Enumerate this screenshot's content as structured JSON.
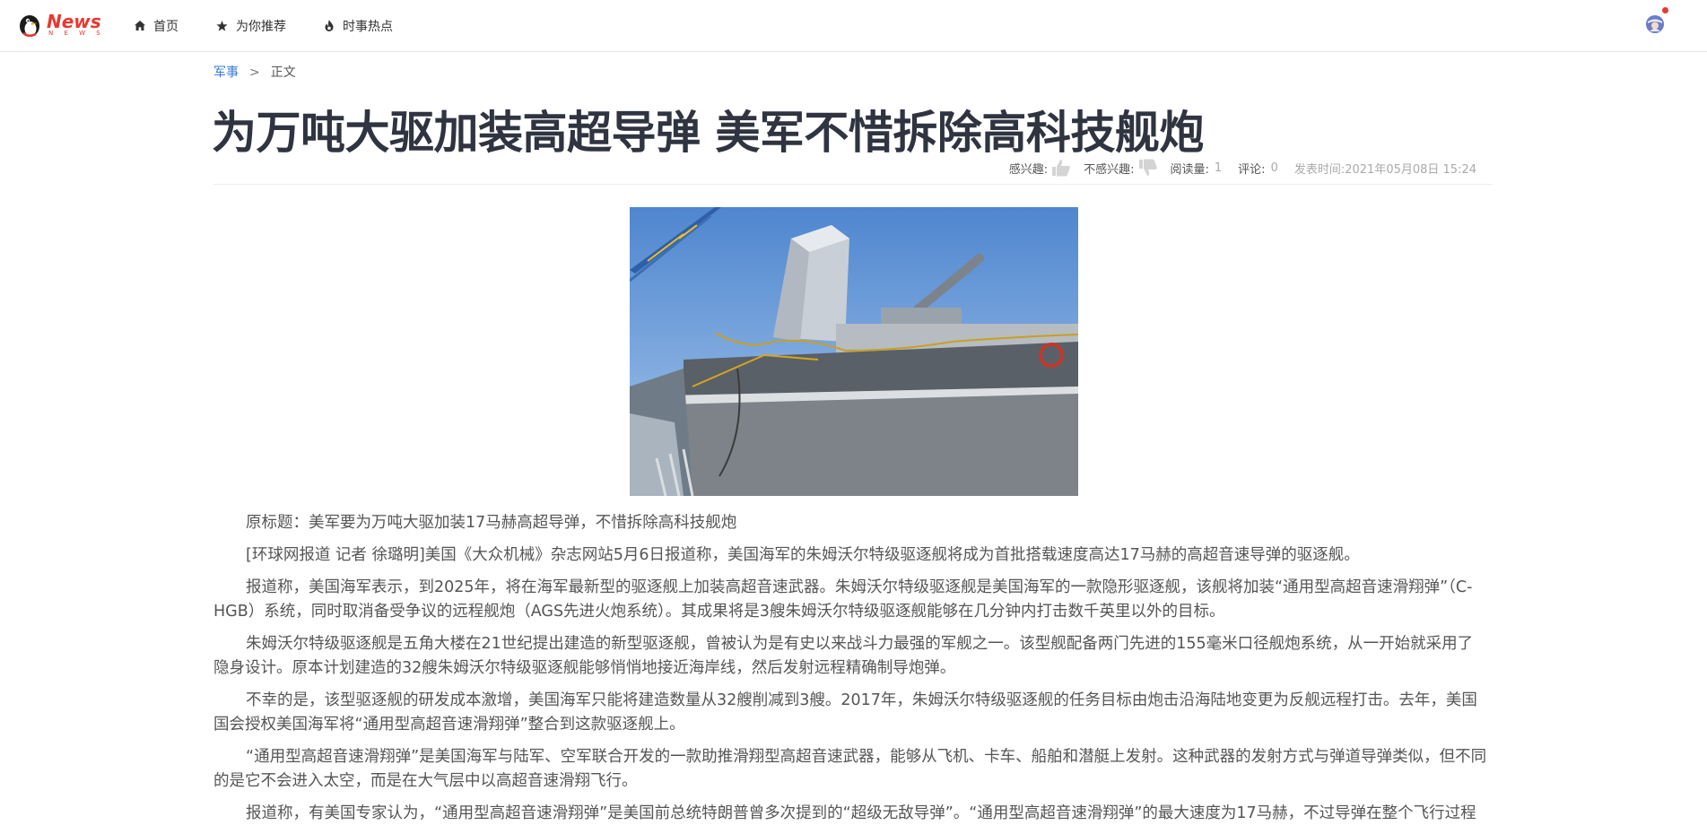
{
  "header": {
    "logo_text": "News",
    "logo_subtext": "N E W S",
    "nav": [
      {
        "label": "首页",
        "icon": "home-icon"
      },
      {
        "label": "为你推荐",
        "icon": "star-icon"
      },
      {
        "label": "时事热点",
        "icon": "fire-icon"
      }
    ],
    "avatar_icon": "user-avatar-icon"
  },
  "breadcrumb": {
    "category": "军事",
    "separator": ">",
    "current": "正文"
  },
  "article": {
    "title": "为万吨大驱加装高超导弹 美军不惜拆除高科技舰炮",
    "meta": {
      "like_label": "感兴趣:",
      "dislike_label": "不感兴趣:",
      "reads_label": "阅读量:",
      "reads_value": "1",
      "comments_label": "评论:",
      "comments_value": "0",
      "published_label": "发表时间:",
      "published_value": "2021年05月08日 15:24"
    },
    "paragraphs": [
      "原标题：美军要为万吨大驱加装17马赫高超导弹，不惜拆除高科技舰炮",
      "[环球网报道 记者 徐璐明]美国《大众机械》杂志网站5月6日报道称，美国海军的朱姆沃尔特级驱逐舰将成为首批搭载速度高达17马赫的高超音速导弹的驱逐舰。",
      "报道称，美国海军表示，到2025年，将在海军最新型的驱逐舰上加装高超音速武器。朱姆沃尔特级驱逐舰是美国海军的一款隐形驱逐舰，该舰将加装“通用型高超音速滑翔弹”（C-HGB）系统，同时取消备受争议的远程舰炮（AGS先进火炮系统）。其成果将是3艘朱姆沃尔特级驱逐舰能够在几分钟内打击数千英里以外的目标。",
      "朱姆沃尔特级驱逐舰是五角大楼在21世纪提出建造的新型驱逐舰，曾被认为是有史以来战斗力最强的军舰之一。该型舰配备两门先进的155毫米口径舰炮系统，从一开始就采用了隐身设计。原本计划建造的32艘朱姆沃尔特级驱逐舰能够悄悄地接近海岸线，然后发射远程精确制导炮弹。",
      "不幸的是，该型驱逐舰的研发成本激增，美国海军只能将建造数量从32艘削减到3艘。2017年，朱姆沃尔特级驱逐舰的任务目标由炮击沿海陆地变更为反舰远程打击。去年，美国国会授权美国海军将“通用型高超音速滑翔弹”整合到这款驱逐舰上。",
      "“通用型高超音速滑翔弹”是美国海军与陆军、空军联合开发的一款助推滑翔型高超音速武器，能够从飞机、卡车、船舶和潜艇上发射。这种武器的发射方式与弹道导弹类似，但不同的是它不会进入太空，而是在大气层中以高超音速滑翔飞行。",
      "报道称，有美国专家认为，“通用型高超音速滑翔弹”是美国前总统特朗普曾多次提到的“超级无敌导弹”。“通用型高超音速滑翔弹”的最大速度为17马赫，不过导弹在整个飞行过程"
    ]
  }
}
